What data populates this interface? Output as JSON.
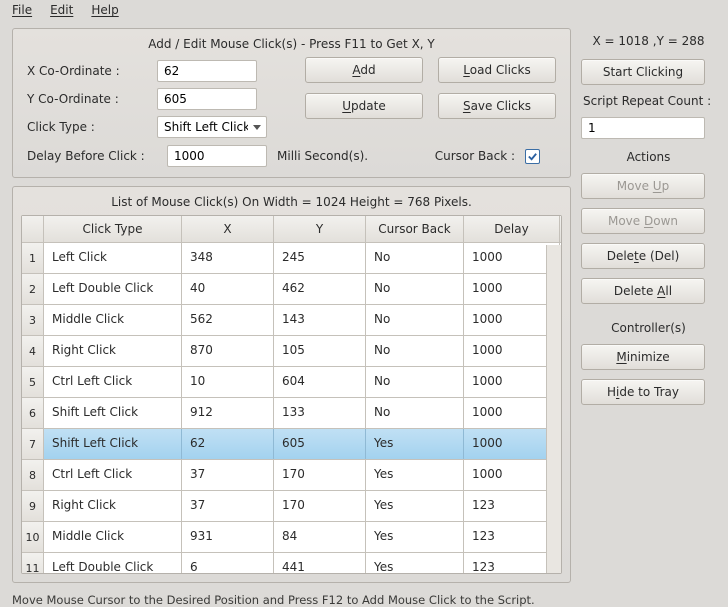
{
  "menu": {
    "file": "File",
    "edit": "Edit",
    "help": "Help"
  },
  "addedit": {
    "title": "Add / Edit Mouse Click(s) - Press F11 to Get X, Y",
    "x_label": "X Co-Ordinate :",
    "y_label": "Y Co-Ordinate :",
    "clicktype_label": "Click Type :",
    "delay_label": "Delay Before Click :",
    "x_value": "62",
    "y_value": "605",
    "clicktype_value": "Shift Left Click",
    "delay_value": "1000",
    "milli": "Milli Second(s).",
    "cursor_back_label": "Cursor Back :",
    "cursor_back_checked": true,
    "btn_add": "Add",
    "btn_load": "Load Clicks",
    "btn_update": "Update",
    "btn_save": "Save Clicks"
  },
  "right": {
    "coords_text": "X = 1018 ,Y = 288",
    "start": "Start Clicking",
    "repeat_label": "Script Repeat Count :",
    "repeat_value": "1",
    "actions_label": "Actions",
    "moveup": "Move Up",
    "movedown": "Move Down",
    "delete": "Delete (Del)",
    "deleteall": "Delete All",
    "controllers_label": "Controller(s)",
    "minimize": "Minimize",
    "hide": "Hide to Tray"
  },
  "list": {
    "title": "List of Mouse Click(s) On Width = 1024 Height = 768 Pixels.",
    "headers": [
      "Click Type",
      "X",
      "Y",
      "Cursor Back",
      "Delay"
    ],
    "selected": 6,
    "rows": [
      {
        "n": 1,
        "type": "Left Click",
        "x": "348",
        "y": "245",
        "cb": "No",
        "d": "1000"
      },
      {
        "n": 2,
        "type": "Left Double Click",
        "x": "40",
        "y": "462",
        "cb": "No",
        "d": "1000"
      },
      {
        "n": 3,
        "type": "Middle Click",
        "x": "562",
        "y": "143",
        "cb": "No",
        "d": "1000"
      },
      {
        "n": 4,
        "type": "Right Click",
        "x": "870",
        "y": "105",
        "cb": "No",
        "d": "1000"
      },
      {
        "n": 5,
        "type": "Ctrl Left Click",
        "x": "10",
        "y": "604",
        "cb": "No",
        "d": "1000"
      },
      {
        "n": 6,
        "type": "Shift Left Click",
        "x": "912",
        "y": "133",
        "cb": "No",
        "d": "1000"
      },
      {
        "n": 7,
        "type": "Shift Left Click",
        "x": "62",
        "y": "605",
        "cb": "Yes",
        "d": "1000"
      },
      {
        "n": 8,
        "type": "Ctrl Left Click",
        "x": "37",
        "y": "170",
        "cb": "Yes",
        "d": "1000"
      },
      {
        "n": 9,
        "type": "Right Click",
        "x": "37",
        "y": "170",
        "cb": "Yes",
        "d": "123"
      },
      {
        "n": 10,
        "type": "Middle Click",
        "x": "931",
        "y": "84",
        "cb": "Yes",
        "d": "123"
      },
      {
        "n": 11,
        "type": "Left Double Click",
        "x": "6",
        "y": "441",
        "cb": "Yes",
        "d": "123"
      }
    ]
  },
  "status": "Move Mouse Cursor to the Desired Position and Press F12 to Add Mouse Click to the Script."
}
